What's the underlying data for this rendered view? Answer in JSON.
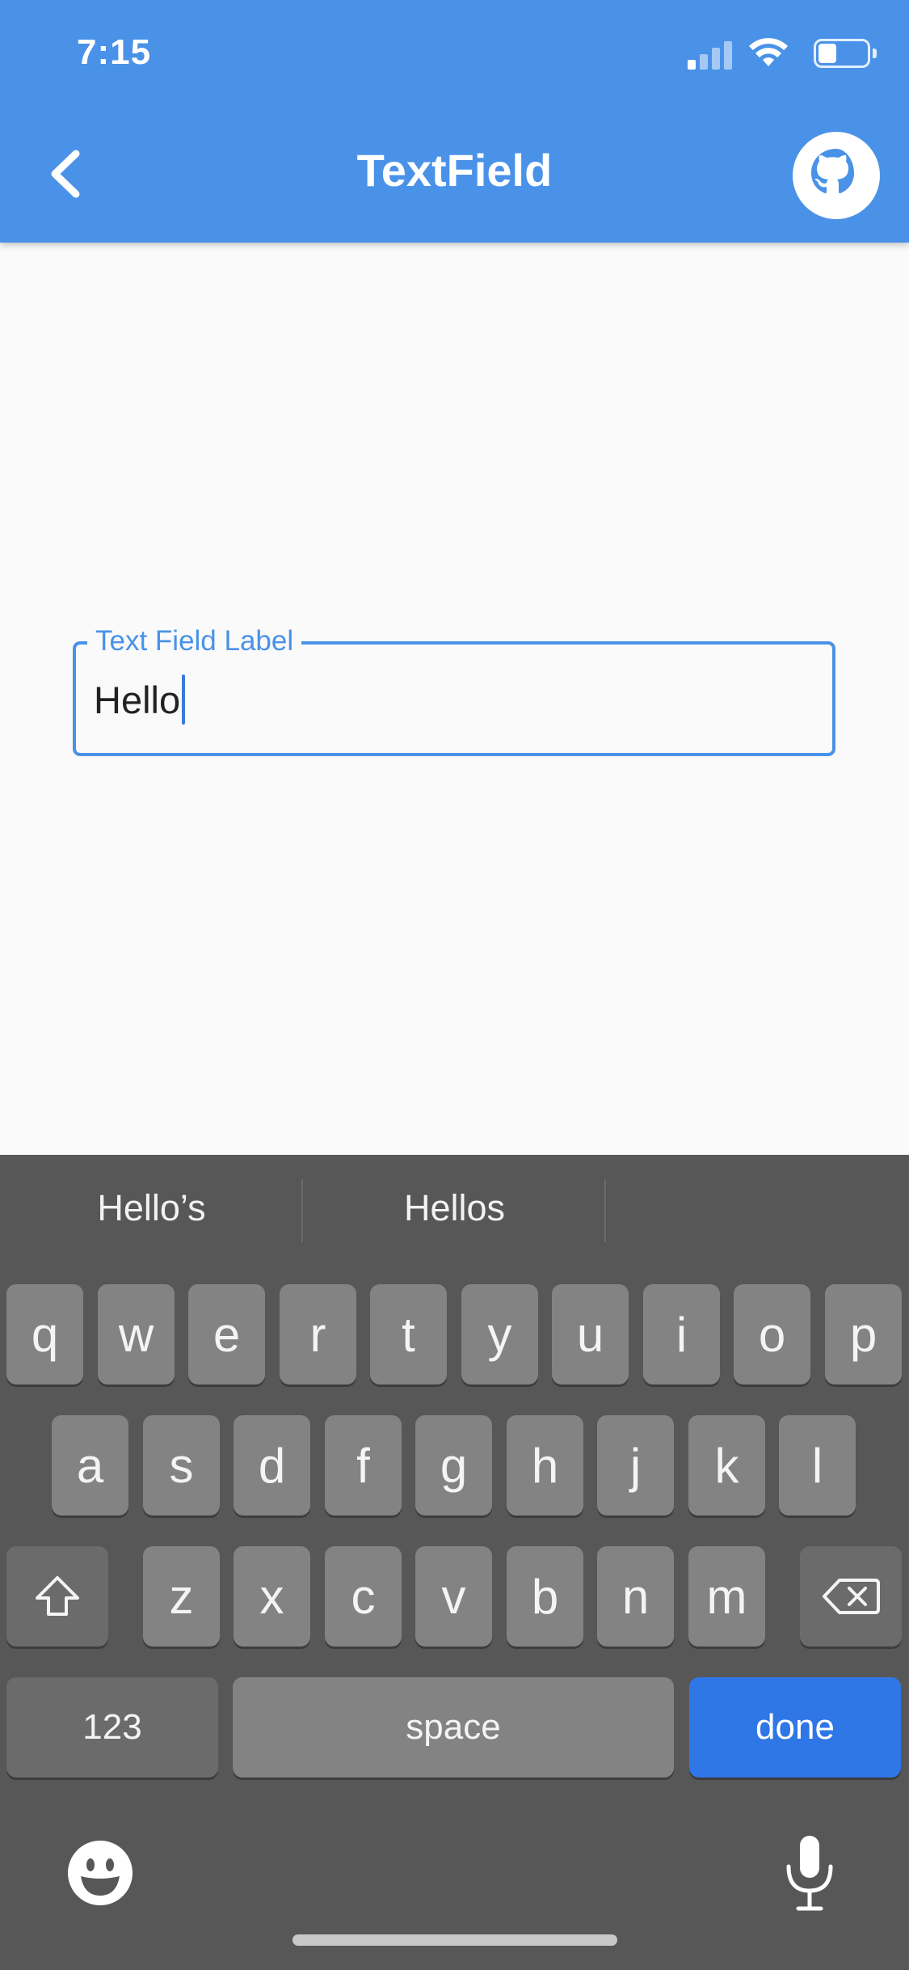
{
  "status_bar": {
    "time": "7:15",
    "signal_bars_active": 1,
    "signal_bars_total": 4,
    "battery_level": 0.3
  },
  "app_bar": {
    "title": "TextField",
    "back_icon": "chevron-left-icon",
    "action_icon": "github-icon",
    "color": "#4a92e8"
  },
  "text_field": {
    "label": "Text Field Label",
    "value": "Hello",
    "border_color": "#4a92e8"
  },
  "keyboard": {
    "suggestions": [
      "Hello’s",
      "Hellos",
      ""
    ],
    "rows": [
      [
        "q",
        "w",
        "e",
        "r",
        "t",
        "y",
        "u",
        "i",
        "o",
        "p"
      ],
      [
        "a",
        "s",
        "d",
        "f",
        "g",
        "h",
        "j",
        "k",
        "l"
      ],
      [
        "z",
        "x",
        "c",
        "v",
        "b",
        "n",
        "m"
      ]
    ],
    "numbers_key": "123",
    "space_key": "space",
    "done_key": "done",
    "done_color": "#2f76e7",
    "shift_icon": "shift-icon",
    "backspace_icon": "backspace-icon",
    "emoji_icon": "emoji-icon",
    "mic_icon": "microphone-icon"
  }
}
